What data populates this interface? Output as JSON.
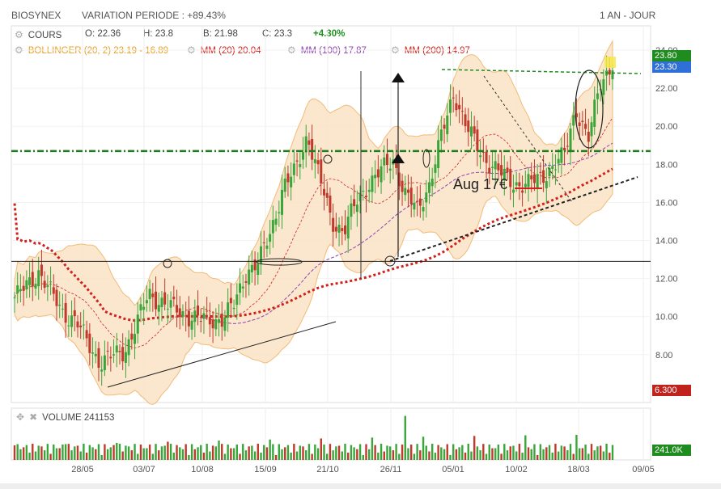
{
  "header": {
    "ticker": "BIOSYNEX",
    "variation": "VARIATION PERIODE : +89.43%",
    "period": "1 AN - JOUR"
  },
  "ohlc": {
    "cours_label": "COURS",
    "open": "O: 22.36",
    "high": "H: 23.8",
    "low": "B: 21.98",
    "close": "C: 23.3",
    "change": "+4.30%"
  },
  "indicators": {
    "bollinger": "BOLLINGER (20, 2)",
    "bollinger_vals": "23.19 - 16.89",
    "mm20": "MM (20)",
    "mm20_val": "20.04",
    "mm100": "MM (100)",
    "mm100_val": "17.87",
    "mm200": "MM (200)",
    "mm200_val": "14.97"
  },
  "price_tags": {
    "high": "23.80",
    "close": "23.30",
    "low": "6.300"
  },
  "volume": {
    "label": "VOLUME",
    "value": "241153",
    "tag": "241.0K"
  },
  "annotation": "Aug 17€",
  "colors": {
    "up": "#3aa63a",
    "down": "#c0392b",
    "band_fill": "#fbe3c6",
    "band_line": "#f0b060",
    "green_tag": "#1e8c1e",
    "blue_tag": "#2e6fd8",
    "red_tag": "#c0221c"
  },
  "chart_data": {
    "type": "candlestick",
    "title": "BIOSYNEX",
    "ylim": [
      6,
      24.3
    ],
    "yticks": [
      "24.00",
      "22.00",
      "20.00",
      "18.00",
      "16.00",
      "14.00",
      "12.00",
      "10.00",
      "8.00"
    ],
    "xlabels": [
      "28/05",
      "03/07",
      "10/08",
      "15/09",
      "21/10",
      "26/11",
      "05/01",
      "10/02",
      "18/03",
      "09/05"
    ],
    "close_series": [
      11.0,
      11.6,
      12.4,
      11.2,
      10.2,
      9.8,
      8.6,
      7.6,
      7.9,
      8.2,
      9.6,
      11.2,
      10.8,
      10.4,
      10.1,
      9.9,
      9.8,
      9.9,
      10.6,
      12.4,
      12.8,
      14.5,
      16.8,
      17.6,
      19.6,
      17.2,
      15.0,
      14.5,
      16.0,
      17.0,
      17.6,
      18.3,
      16.4,
      15.6,
      17.0,
      19.5,
      21.8,
      20.0,
      18.8,
      18.0,
      17.4,
      17.0,
      16.9,
      17.3,
      17.8,
      18.4,
      21.0,
      19.2,
      22.36,
      23.3
    ],
    "resistance_level": 18.7,
    "support_level": 12.9
  }
}
